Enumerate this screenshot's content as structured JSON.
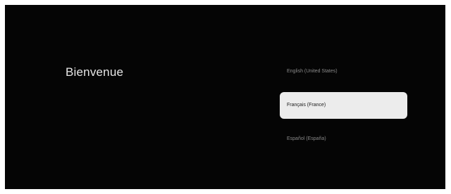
{
  "welcome": {
    "title": "Bienvenue"
  },
  "languages": {
    "items": [
      {
        "label": "English (United States)",
        "selected": false
      },
      {
        "label": "Français (France)",
        "selected": true
      },
      {
        "label": "Español (España)",
        "selected": false
      }
    ]
  },
  "colors": {
    "background": "#050505",
    "frame": "#ffffff",
    "selected_bg": "#ececec",
    "selected_text": "#1a1a1a",
    "unselected_text": "#8a8a8a",
    "title_text": "#e6e6e6"
  }
}
